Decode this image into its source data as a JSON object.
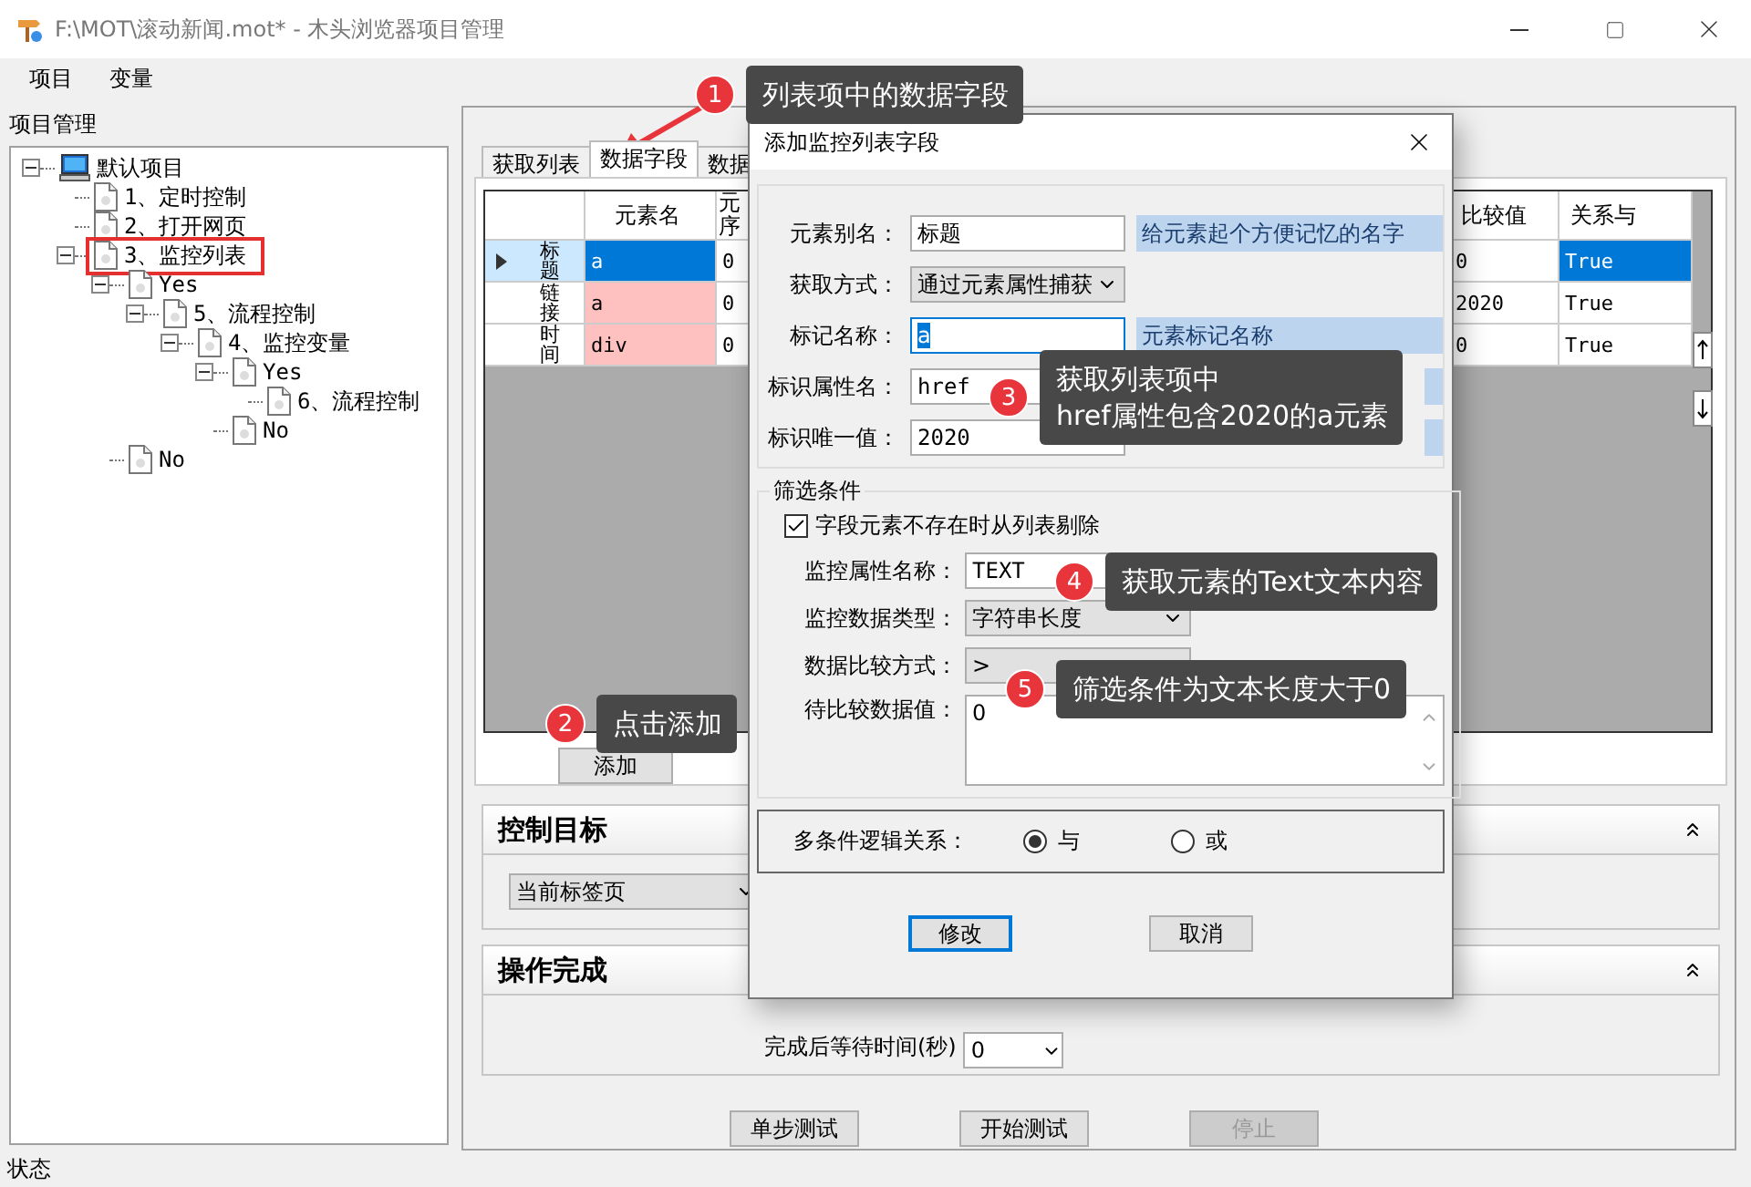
{
  "window": {
    "title": "F:\\MOT\\滚动新闻.mot* - 木头浏览器项目管理"
  },
  "menu": [
    {
      "label": "项目"
    },
    {
      "label": "变量"
    }
  ],
  "project_panel": {
    "title": "项目管理",
    "tree": [
      {
        "label": "默认项目",
        "kind": "computer",
        "expanded": true,
        "highlighted": false,
        "children": [
          {
            "label": "1、定时控制",
            "kind": "page",
            "highlighted": false
          },
          {
            "label": "2、打开网页",
            "kind": "page",
            "highlighted": false
          },
          {
            "label": "3、监控列表",
            "kind": "page",
            "expanded": true,
            "highlighted": true,
            "children": [
              {
                "label": "Yes",
                "kind": "page",
                "expanded": true,
                "highlighted": false,
                "children": [
                  {
                    "label": "5、流程控制",
                    "kind": "page",
                    "expanded": true,
                    "highlighted": false,
                    "children": [
                      {
                        "label": "4、监控变量",
                        "kind": "page",
                        "expanded": true,
                        "highlighted": false,
                        "children": [
                          {
                            "label": "Yes",
                            "kind": "page",
                            "expanded": true,
                            "highlighted": false,
                            "children": [
                              {
                                "label": "6、流程控制",
                                "kind": "page",
                                "highlighted": false
                              }
                            ]
                          },
                          {
                            "label": "No",
                            "kind": "page",
                            "highlighted": false
                          }
                        ]
                      }
                    ]
                  }
                ]
              },
              {
                "label": "No",
                "kind": "page",
                "highlighted": false
              }
            ]
          }
        ]
      }
    ]
  },
  "tabs": [
    {
      "label": "获取列表",
      "selected": false
    },
    {
      "label": "数据字段",
      "selected": true
    },
    {
      "label": "数据",
      "selected": false
    }
  ],
  "grid": {
    "columns": [
      {
        "label": "元素名"
      },
      {
        "label": "元序"
      },
      {
        "label": "比较值"
      },
      {
        "label": "关系与"
      }
    ],
    "rows": [
      {
        "name": "标题",
        "selected": true,
        "cells": [
          "a",
          "0",
          "0",
          "True"
        ]
      },
      {
        "name": "链接",
        "selected": false,
        "cells": [
          "a",
          "0",
          "2020",
          "True"
        ]
      },
      {
        "name": "时间",
        "selected": false,
        "cells": [
          "div",
          "0",
          "0",
          "True"
        ]
      }
    ]
  },
  "add_button": {
    "label": "添加"
  },
  "control_target": {
    "title": "控制目标",
    "target": "当前标签页"
  },
  "operation_done": {
    "title": "操作完成",
    "wait_label": "完成后等待时间(秒)",
    "wait_value": "0"
  },
  "test_buttons": [
    {
      "label": "单步测试",
      "disabled": false
    },
    {
      "label": "开始测试",
      "disabled": false
    },
    {
      "label": "停止",
      "disabled": true
    }
  ],
  "status_bar": {
    "text": "状态"
  },
  "dialog": {
    "title": "添加监控列表字段",
    "fields": [
      {
        "label": "元素别名：",
        "kind": "input",
        "value": "标题",
        "focused": false,
        "hint": "给元素起个方便记忆的名字"
      },
      {
        "label": "获取方式：",
        "kind": "select",
        "value": "通过元素属性捕获"
      },
      {
        "label": "标记名称：",
        "kind": "input",
        "value": "a",
        "focused": true,
        "hint": "元素标记名称"
      },
      {
        "label": "标识属性名：",
        "kind": "combo",
        "value": "href"
      },
      {
        "label": "标识唯一值：",
        "kind": "combo",
        "value": "2020"
      }
    ],
    "filter": {
      "title": "筛选条件",
      "remove_missing": {
        "label": "字段元素不存在时从列表剔除",
        "checked": true
      },
      "fields": [
        {
          "label": "监控属性名称：",
          "kind": "input",
          "value": "TEXT",
          "focused": false
        },
        {
          "label": "监控数据类型：",
          "kind": "select",
          "value": "字符串长度"
        },
        {
          "label": "数据比较方式：",
          "kind": "picker",
          "value": ">"
        },
        {
          "label": "待比较数据值：",
          "kind": "textarea",
          "value": "0"
        }
      ]
    },
    "logic": {
      "label": "多条件逻辑关系：",
      "options": [
        {
          "label": "与",
          "selected": true
        },
        {
          "label": "或",
          "selected": false
        }
      ]
    },
    "buttons": [
      {
        "label": "修改",
        "default": true
      },
      {
        "label": "取消",
        "default": false
      }
    ]
  },
  "callouts": [
    {
      "number": "1",
      "text": "列表项中的数据字段"
    },
    {
      "number": "2",
      "text": "点击添加"
    },
    {
      "number": "3",
      "text": "获取列表项中\nhref属性包含2020的a元素"
    },
    {
      "number": "4",
      "text": "获取元素的Text文本内容"
    },
    {
      "number": "5",
      "text": "筛选条件为文本长度大于0"
    }
  ]
}
